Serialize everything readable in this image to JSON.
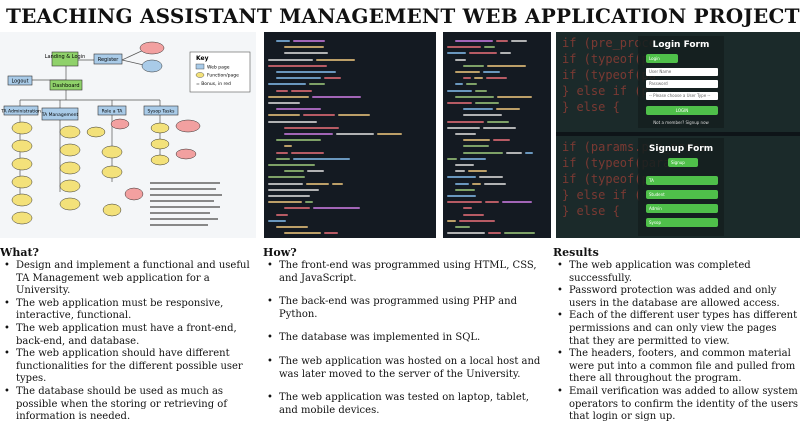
{
  "title": "TEACHING ASSISTANT MANAGEMENT WEB APPLICATION PROJECT",
  "diagram": {
    "nodes": {
      "landing": "Landing & Login",
      "register": "Register",
      "logout": "Logout",
      "dashboard": "Dashboard",
      "ta_admin": "TA Administration",
      "ta_mgmt": "TA Management",
      "role_ta": "Role a TA",
      "sysop": "Sysop Tasks"
    },
    "legend": {
      "title": "Key",
      "web_page": "Web page",
      "function_page": "Function/page",
      "bonus": "= Bonus, in red"
    }
  },
  "login_form": {
    "title": "Login Form",
    "tab": "Login",
    "username_placeholder": "User Name",
    "password_placeholder": "Password",
    "select": "-- Please choose a User Type --",
    "button": "LOGIN",
    "footer": "Not a member? Signup now"
  },
  "signup_form": {
    "title": "Signup Form",
    "tab": "Signup",
    "options": [
      "TA",
      "Student",
      "Admin",
      "Sysop"
    ]
  },
  "what": {
    "heading": "What?",
    "items": [
      "Design and implement a functional and useful TA Management web application for a University.",
      "The web application must be responsive, interactive, functional.",
      "The web application must have a front-end, back-end, and database.",
      "The web application should have different functionalities for the different possible user types.",
      "The database should be used as much as possible when the storing or retrieving of information is needed."
    ]
  },
  "how": {
    "heading": "How?",
    "items": [
      "The front-end was programmed using HTML, CSS, and JavaScript.",
      "The back-end was programmed using PHP and Python.",
      "The database was implemented in SQL.",
      "The web application was hosted on a local host and was later moved to the server of the University.",
      "The web application was tested on laptop, tablet, and mobile devices."
    ]
  },
  "results": {
    "heading": "Results",
    "items": [
      "The web application was completed successfully.",
      "Password protection was added and only users in the database are allowed access.",
      "Each of the different user types has different permissions and can only view the pages that they are permitted to view.",
      "The headers, footers, and common material were put into a common file and pulled from there all throughout the program.",
      "Email verification was added to allow system operators to confirm the identity of the users that login or sign up."
    ]
  },
  "colors": {
    "green_button": "#4fc04a",
    "code_bg": "#141a22",
    "node_green": "#8fd16a",
    "node_blue": "#a9cbe8",
    "node_pink": "#f2a0a0",
    "node_yellow": "#f3e17a"
  }
}
